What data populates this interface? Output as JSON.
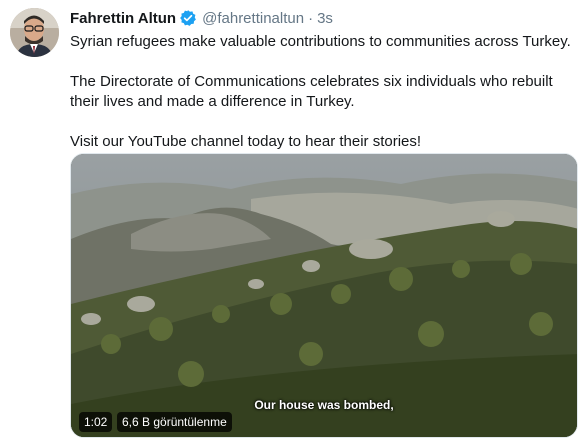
{
  "author": {
    "display_name": "Fahrettin Altun",
    "handle": "@fahrettinaltun",
    "separator": "·",
    "time": "3s",
    "verified": true
  },
  "tweet": {
    "paragraphs": [
      "Syrian refugees make valuable contributions to communities across Turkey.",
      "The Directorate of Communications celebrates six individuals who rebuilt their lives and made a difference in Turkey.",
      "Visit our YouTube channel today to hear their stories!"
    ]
  },
  "video": {
    "subtitle": "Our house was bombed,",
    "duration": "1:02",
    "views": "6,6 B görüntülenme"
  },
  "colors": {
    "verified_badge": "#1da1f2",
    "secondary_text": "#657786"
  },
  "icons": {
    "verified": "verified-badge-icon"
  }
}
